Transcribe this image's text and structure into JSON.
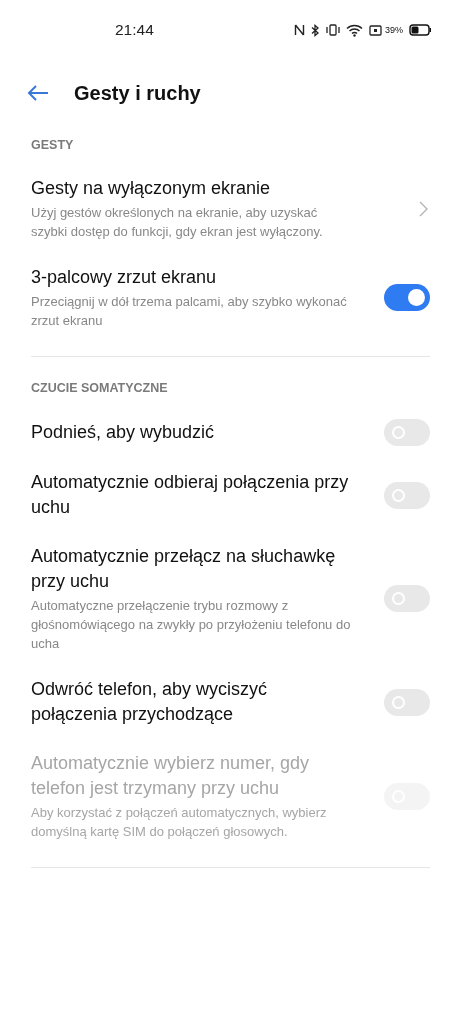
{
  "status_bar": {
    "time": "21:44",
    "battery_percent": "39%"
  },
  "header": {
    "title": "Gesty i ruchy"
  },
  "sections": [
    {
      "title": "GESTY",
      "items": [
        {
          "kind": "link",
          "title": "Gesty na wyłączonym ekranie",
          "subtitle": "Użyj gestów określonych na ekranie, aby uzyskać szybki dostęp do funkcji, gdy ekran jest wyłączony.",
          "disabled": false
        },
        {
          "kind": "toggle",
          "title": "3-palcowy zrzut ekranu",
          "subtitle": "Przeciągnij w dół trzema palcami, aby szybko wykonać zrzut ekranu",
          "on": true,
          "disabled": false
        }
      ]
    },
    {
      "title": "CZUCIE SOMATYCZNE",
      "items": [
        {
          "kind": "toggle",
          "title": "Podnieś, aby wybudzić",
          "on": false,
          "disabled": false
        },
        {
          "kind": "toggle",
          "title": "Automatycznie odbieraj połączenia przy uchu",
          "on": false,
          "disabled": false
        },
        {
          "kind": "toggle",
          "title": "Automatycznie przełącz na słuchawkę przy uchu",
          "subtitle": "Automatyczne przełączenie trybu rozmowy z głośnomówiącego na zwykły po przyłożeniu telefonu do ucha",
          "on": false,
          "disabled": false
        },
        {
          "kind": "toggle",
          "title": "Odwróć telefon, aby wyciszyć połączenia przychodzące",
          "on": false,
          "disabled": false
        },
        {
          "kind": "toggle",
          "title": "Automatycznie wybierz numer, gdy telefon jest trzymany przy uchu",
          "subtitle": "Aby korzystać z połączeń automatycznych, wybierz domyślną kartę SIM do połączeń głosowych.",
          "on": false,
          "disabled": true
        }
      ]
    }
  ]
}
